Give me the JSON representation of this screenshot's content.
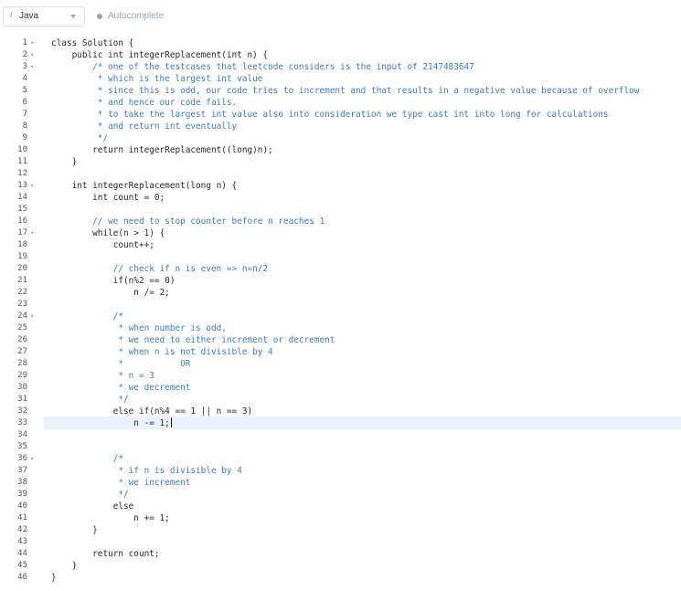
{
  "toolbar": {
    "language": "Java",
    "language_icon": "i",
    "autocomplete_label": "Autocomplete"
  },
  "editor": {
    "active_line": 33,
    "fold_lines": [
      1,
      2,
      3,
      13,
      17,
      24,
      36
    ],
    "lines": [
      {
        "n": "1",
        "t": "class Solution {",
        "c": false
      },
      {
        "n": "2",
        "t": "    public int integerReplacement(int n) {",
        "c": false
      },
      {
        "n": "3",
        "t": "        /* one of the testcases that leetcode considers is the input of 2147483647",
        "c": true
      },
      {
        "n": "4",
        "t": "         * which is the largest int value",
        "c": true
      },
      {
        "n": "5",
        "t": "         * since this is odd, our code tries to increment and that results in a negative value because of overflow",
        "c": true
      },
      {
        "n": "6",
        "t": "         * and hence our code fails.",
        "c": true
      },
      {
        "n": "7",
        "t": "         * to take the largest int value also into consideration we type cast int into long for calculations",
        "c": true
      },
      {
        "n": "8",
        "t": "         * and return int eventually",
        "c": true
      },
      {
        "n": "9",
        "t": "         */",
        "c": true
      },
      {
        "n": "10",
        "t": "        return integerReplacement((long)n);",
        "c": false
      },
      {
        "n": "11",
        "t": "    }",
        "c": false
      },
      {
        "n": "12",
        "t": "",
        "c": false
      },
      {
        "n": "13",
        "t": "    int integerReplacement(long n) {",
        "c": false
      },
      {
        "n": "14",
        "t": "        int count = 0;",
        "c": false
      },
      {
        "n": "15",
        "t": "",
        "c": false
      },
      {
        "n": "16",
        "t": "        // we need to stop counter before n reaches 1",
        "c": true
      },
      {
        "n": "17",
        "t": "        while(n > 1) {",
        "c": false
      },
      {
        "n": "18",
        "t": "            count++;",
        "c": false
      },
      {
        "n": "19",
        "t": "",
        "c": false
      },
      {
        "n": "20",
        "t": "            // check if n is even => n=n/2",
        "c": true
      },
      {
        "n": "21",
        "t": "            if(n%2 == 0)",
        "c": false
      },
      {
        "n": "22",
        "t": "                n /= 2;",
        "c": false
      },
      {
        "n": "23",
        "t": "",
        "c": false
      },
      {
        "n": "24",
        "t": "            /*",
        "c": true
      },
      {
        "n": "25",
        "t": "             * when number is odd,",
        "c": true
      },
      {
        "n": "26",
        "t": "             * we need to either increment or decrement",
        "c": true
      },
      {
        "n": "27",
        "t": "             * when n is not divisible by 4",
        "c": true
      },
      {
        "n": "28",
        "t": "             *           OR",
        "c": true
      },
      {
        "n": "29",
        "t": "             * n = 3",
        "c": true
      },
      {
        "n": "30",
        "t": "             * we decrement",
        "c": true
      },
      {
        "n": "31",
        "t": "             */",
        "c": true
      },
      {
        "n": "32",
        "t": "            else if(n%4 == 1 || n == 3)",
        "c": false
      },
      {
        "n": "33",
        "t": "                n -= 1;",
        "c": false
      },
      {
        "n": "34",
        "t": "",
        "c": false
      },
      {
        "n": "35",
        "t": "",
        "c": false
      },
      {
        "n": "36",
        "t": "            /*",
        "c": true
      },
      {
        "n": "37",
        "t": "             * if n is divisible by 4",
        "c": true
      },
      {
        "n": "38",
        "t": "             * we increment",
        "c": true
      },
      {
        "n": "39",
        "t": "             */",
        "c": true
      },
      {
        "n": "40",
        "t": "            else",
        "c": false
      },
      {
        "n": "41",
        "t": "                n += 1;",
        "c": false
      },
      {
        "n": "42",
        "t": "        }",
        "c": false
      },
      {
        "n": "43",
        "t": "",
        "c": false
      },
      {
        "n": "44",
        "t": "        return count;",
        "c": false
      },
      {
        "n": "45",
        "t": "    }",
        "c": false
      },
      {
        "n": "46",
        "t": "}",
        "c": false
      }
    ]
  }
}
